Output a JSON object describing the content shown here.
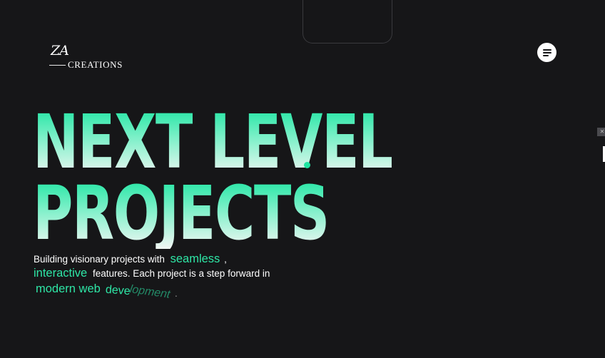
{
  "header": {
    "logo_mark": "ZA",
    "logo_text": "CREATIONS",
    "menu_icon": "hamburger-menu-icon"
  },
  "edge": {
    "close_glyph": "✕"
  },
  "hero": {
    "headline_line1": "NEXT LEVEL",
    "headline_line2": "PROJECTS",
    "desc_part1": "Building visionary projects with",
    "desc_hl1": "seamless",
    "desc_part2": ",",
    "desc_hl2": "interactive",
    "desc_part3": "features. Each project is a step forward in",
    "desc_hl3": "modern web",
    "desc_wavy1": "deve",
    "desc_wavy2": "lopment",
    "desc_end": "."
  },
  "colors": {
    "background": "#161618",
    "accent": "#1fe5a2",
    "text": "#ffffff"
  }
}
